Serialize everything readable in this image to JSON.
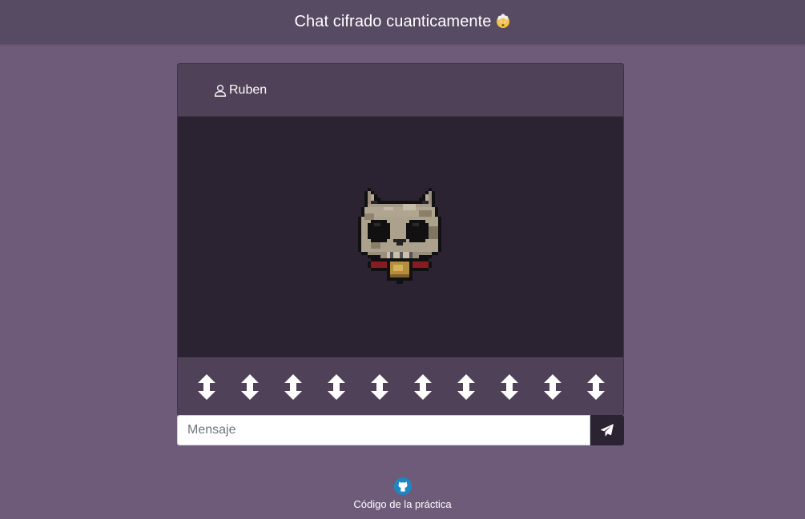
{
  "header": {
    "title": "Chat cifrado cuanticamente",
    "emoji_icon": "exploding-head-emoji"
  },
  "chat": {
    "user_icon": "user-icon",
    "username": "Ruben",
    "avatar": "pixel-skull-cat-avatar",
    "qubit_buttons": [
      {
        "icon": "up-down-arrow-icon"
      },
      {
        "icon": "up-down-arrow-icon"
      },
      {
        "icon": "up-down-arrow-icon"
      },
      {
        "icon": "up-down-arrow-icon"
      },
      {
        "icon": "up-down-arrow-icon"
      },
      {
        "icon": "up-down-arrow-icon"
      },
      {
        "icon": "up-down-arrow-icon"
      },
      {
        "icon": "up-down-arrow-icon"
      },
      {
        "icon": "up-down-arrow-icon"
      },
      {
        "icon": "up-down-arrow-icon"
      }
    ]
  },
  "composer": {
    "placeholder": "Mensaje",
    "value": "",
    "send_icon": "paper-plane-icon"
  },
  "footer": {
    "icon": "github-icon",
    "link_text": "Código de la práctica"
  },
  "colors": {
    "page_bg": "#6e5b79",
    "topbar_bg": "#574a63",
    "card_header_bg": "#4f4157",
    "card_body_bg": "#2b2331",
    "accent": "#1f86c6"
  }
}
